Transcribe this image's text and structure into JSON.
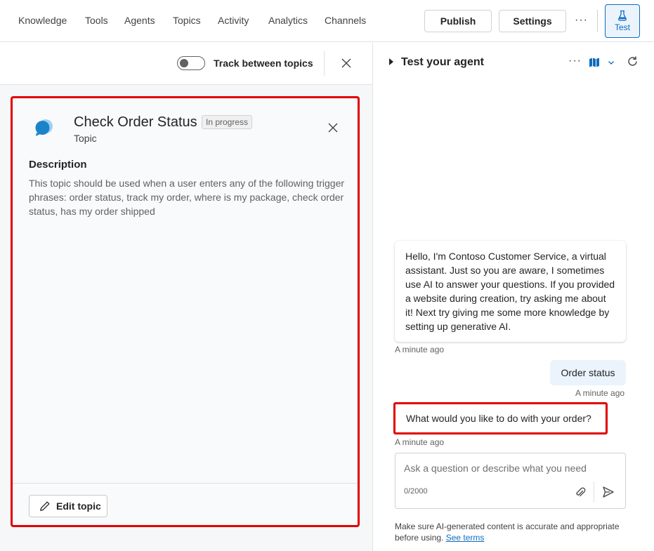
{
  "nav": {
    "items": [
      "Knowledge",
      "Tools",
      "Agents",
      "Topics",
      "Activity",
      "Analytics",
      "Channels"
    ],
    "publish_label": "Publish",
    "settings_label": "Settings",
    "more_label": "···",
    "test_label": "Test"
  },
  "toolbar": {
    "toggle_label": "Track between topics",
    "toggle_on": false
  },
  "topic_card": {
    "title": "Check Order Status",
    "status_badge": "In progress",
    "subtitle": "Topic",
    "description_heading": "Description",
    "description": "This topic should be used when a user enters any of the following trigger phrases: order status, track my order, where is my package, check order status, has my order shipped",
    "edit_label": "Edit topic"
  },
  "test_panel": {
    "title": "Test your agent",
    "more_label": "···",
    "messages": [
      {
        "from": "bot",
        "text": "Hello, I'm Contoso Customer Service, a virtual assistant. Just so you are aware, I sometimes use AI to answer your questions. If you provided a website during creation, try asking me about it! Next try giving me some more knowledge by setting up generative AI.",
        "time": "A minute ago"
      },
      {
        "from": "user",
        "text": "Order status",
        "time": "A minute ago"
      },
      {
        "from": "bot",
        "text": "What would you like to do with your order?",
        "time": "A minute ago"
      }
    ],
    "input_placeholder": "Ask a question or describe what you need",
    "char_count": "0/2000",
    "disclaimer": "Make sure AI-generated content is accurate and appropriate before using.",
    "see_terms": "See terms"
  },
  "colors": {
    "accent": "#0f6cbd",
    "highlight": "#e00000"
  }
}
